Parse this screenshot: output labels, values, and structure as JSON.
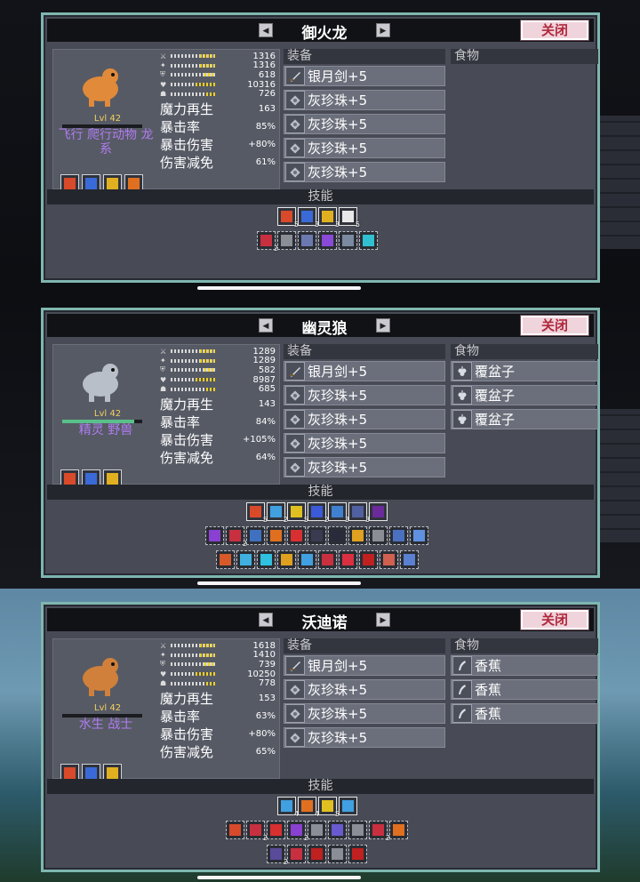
{
  "panels": [
    {
      "title": "御火龙",
      "close_label": "关闭",
      "level": "Lvl 42",
      "tags": "飞行 爬行动物 龙系",
      "portrait_color": "#e08a3a",
      "stats": [
        1316,
        1316,
        618,
        10316,
        726
      ],
      "sub_stats": [
        {
          "label": "魔力再生",
          "value": "163"
        },
        {
          "label": "暴击率",
          "value": "85%"
        },
        {
          "label": "暴击伤害",
          "value": "+80%"
        },
        {
          "label": "伤害减免",
          "value": "61%"
        }
      ],
      "equip_label": "装备",
      "food_label": "食物",
      "equipment": [
        "银月剑+5",
        "灰珍珠+5",
        "灰珍珠+5",
        "灰珍珠+5",
        "灰珍珠+5"
      ],
      "food": [],
      "skills_label": "技能",
      "skills_row1": [
        {
          "c": "#d84a2a",
          "n": "5"
        },
        {
          "c": "#3a6ad8",
          "n": "3"
        },
        {
          "c": "#e0b020",
          "n": "3"
        },
        {
          "c": "#e8e8e8",
          "n": "5"
        }
      ],
      "skills_row2": [
        {
          "c": "#c83040",
          "n": "2"
        },
        {
          "c": "#8a8e96",
          "n": ""
        },
        {
          "c": "#6a7ab0",
          "n": ""
        },
        {
          "c": "#8a4ad8",
          "n": ""
        },
        {
          "c": "#7a8aa0",
          "n": ""
        },
        {
          "c": "#30c0d0",
          "n": ""
        }
      ]
    },
    {
      "title": "幽灵狼",
      "close_label": "关闭",
      "level": "Lvl 42",
      "tags": "精灵 野兽",
      "portrait_color": "#b8bfc8",
      "stats": [
        1289,
        1289,
        582,
        8987,
        685
      ],
      "sub_stats": [
        {
          "label": "魔力再生",
          "value": "143"
        },
        {
          "label": "暴击率",
          "value": "84%"
        },
        {
          "label": "暴击伤害",
          "value": "+105%"
        },
        {
          "label": "伤害减免",
          "value": "64%"
        }
      ],
      "equip_label": "装备",
      "food_label": "食物",
      "equipment": [
        "银月剑+5",
        "灰珍珠+5",
        "灰珍珠+5",
        "灰珍珠+5",
        "灰珍珠+5"
      ],
      "food": [
        "覆盆子",
        "覆盆子",
        "覆盆子"
      ],
      "skills_label": "技能",
      "skills_row1": [
        {
          "c": "#d84a2a",
          "n": "5"
        },
        {
          "c": "#40a0e0",
          "n": "2"
        },
        {
          "c": "#e0c020",
          "n": "5"
        },
        {
          "c": "#3a5ad8",
          "n": "2"
        },
        {
          "c": "#4080d0",
          "n": "3"
        },
        {
          "c": "#5060a0",
          "n": "3"
        },
        {
          "c": "#6a2a9a",
          "n": ""
        }
      ],
      "skills_row2": [
        {
          "c": "#8a40d0",
          "n": ""
        },
        {
          "c": "#c83040",
          "n": "2"
        },
        {
          "c": "#4070c0",
          "n": ""
        },
        {
          "c": "#e07020",
          "n": ""
        },
        {
          "c": "#d83030",
          "n": ""
        },
        {
          "c": "#3a3a50",
          "n": ""
        },
        {
          "c": "#2a2a3a",
          "n": ""
        },
        {
          "c": "#e0a020",
          "n": ""
        },
        {
          "c": "#8a8e96",
          "n": ""
        },
        {
          "c": "#4a70c0",
          "n": ""
        },
        {
          "c": "#6090e0",
          "n": ""
        }
      ],
      "skills_row3": [
        {
          "c": "#d85a2a",
          "n": ""
        },
        {
          "c": "#40b0e0",
          "n": ""
        },
        {
          "c": "#30c0e0",
          "n": ""
        },
        {
          "c": "#e0a020",
          "n": ""
        },
        {
          "c": "#40a0e0",
          "n": ""
        },
        {
          "c": "#c83040",
          "n": ""
        },
        {
          "c": "#d83040",
          "n": ""
        },
        {
          "c": "#c02020",
          "n": ""
        },
        {
          "c": "#d06050",
          "n": ""
        },
        {
          "c": "#5a80d0",
          "n": ""
        }
      ]
    },
    {
      "title": "沃迪诺",
      "close_label": "关闭",
      "level": "Lvl 42",
      "tags": "水生 战士",
      "portrait_color": "#d0803a",
      "stats": [
        1618,
        1410,
        739,
        10250,
        778
      ],
      "sub_stats": [
        {
          "label": "魔力再生",
          "value": "153"
        },
        {
          "label": "暴击率",
          "value": "63%"
        },
        {
          "label": "暴击伤害",
          "value": "+80%"
        },
        {
          "label": "伤害减免",
          "value": "65%"
        }
      ],
      "equip_label": "装备",
      "food_label": "食物",
      "equipment": [
        "银月剑+5",
        "灰珍珠+5",
        "灰珍珠+5",
        "灰珍珠+5"
      ],
      "food": [
        "香蕉",
        "香蕉",
        "香蕉"
      ],
      "skills_label": "技能",
      "skills_row1": [
        {
          "c": "#40a0e0",
          "n": "4"
        },
        {
          "c": "#e07020",
          "n": "4"
        },
        {
          "c": "#e0c020",
          "n": "5"
        },
        {
          "c": "#40a0e0",
          "n": ""
        }
      ],
      "skills_row2": [
        {
          "c": "#d84a2a",
          "n": ""
        },
        {
          "c": "#c83040",
          "n": "2"
        },
        {
          "c": "#d83030",
          "n": ""
        },
        {
          "c": "#8a40d0",
          "n": "2"
        },
        {
          "c": "#8a8e96",
          "n": ""
        },
        {
          "c": "#6a5ad0",
          "n": ""
        },
        {
          "c": "#8a8e96",
          "n": ""
        },
        {
          "c": "#c83040",
          "n": "2"
        },
        {
          "c": "#e07020",
          "n": ""
        }
      ],
      "skills_row3": [
        {
          "c": "#5a4a9a",
          "n": "2"
        },
        {
          "c": "#c83040",
          "n": ""
        },
        {
          "c": "#c02020",
          "n": ""
        },
        {
          "c": "#8a8e96",
          "n": ""
        },
        {
          "c": "#c02020",
          "n": ""
        }
      ]
    }
  ]
}
